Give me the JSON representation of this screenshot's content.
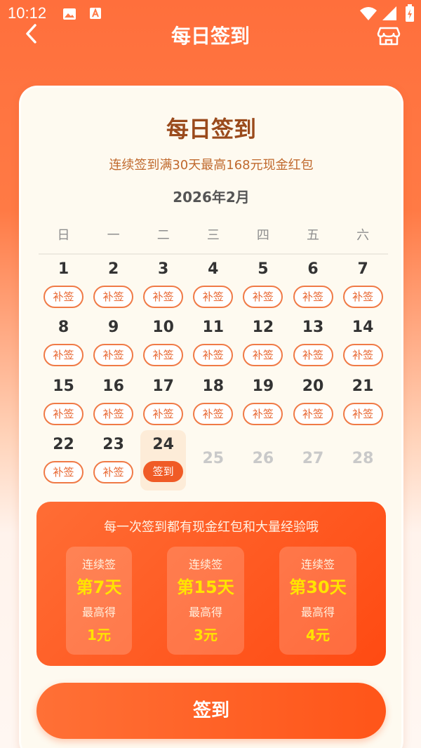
{
  "status_bar": {
    "time": "10:12"
  },
  "header": {
    "title": "每日签到"
  },
  "card": {
    "title": "每日签到",
    "subtitle": "连续签到满30天最高168元现金红包",
    "month": "2026年2月",
    "weekdays": [
      "日",
      "一",
      "二",
      "三",
      "四",
      "五",
      "六"
    ],
    "makeup_label": "补签",
    "sign_label": "签到",
    "days": [
      {
        "day": "1",
        "state": "missed"
      },
      {
        "day": "2",
        "state": "missed"
      },
      {
        "day": "3",
        "state": "missed"
      },
      {
        "day": "4",
        "state": "missed"
      },
      {
        "day": "5",
        "state": "missed"
      },
      {
        "day": "6",
        "state": "missed"
      },
      {
        "day": "7",
        "state": "missed"
      },
      {
        "day": "8",
        "state": "missed"
      },
      {
        "day": "9",
        "state": "missed"
      },
      {
        "day": "10",
        "state": "missed"
      },
      {
        "day": "11",
        "state": "missed"
      },
      {
        "day": "12",
        "state": "missed"
      },
      {
        "day": "13",
        "state": "missed"
      },
      {
        "day": "14",
        "state": "missed"
      },
      {
        "day": "15",
        "state": "missed"
      },
      {
        "day": "16",
        "state": "missed"
      },
      {
        "day": "17",
        "state": "missed"
      },
      {
        "day": "18",
        "state": "missed"
      },
      {
        "day": "19",
        "state": "missed"
      },
      {
        "day": "20",
        "state": "missed"
      },
      {
        "day": "21",
        "state": "missed"
      },
      {
        "day": "22",
        "state": "missed"
      },
      {
        "day": "23",
        "state": "missed"
      },
      {
        "day": "24",
        "state": "today"
      },
      {
        "day": "25",
        "state": "future"
      },
      {
        "day": "26",
        "state": "future"
      },
      {
        "day": "27",
        "state": "future"
      },
      {
        "day": "28",
        "state": "future"
      }
    ]
  },
  "rewards": {
    "title": "每一次签到都有现金红包和大量经验哦",
    "items": [
      {
        "line1": "连续签",
        "days": "第7天",
        "line3": "最高得",
        "amount": "1元"
      },
      {
        "line1": "连续签",
        "days": "第15天",
        "line3": "最高得",
        "amount": "3元"
      },
      {
        "line1": "连续签",
        "days": "第30天",
        "line3": "最高得",
        "amount": "4元"
      }
    ]
  },
  "sign_button": {
    "label": "签到"
  },
  "colors": {
    "accent": "#ff5a1f",
    "title_brown": "#9a4a1c",
    "reward_gold": "#ffe400"
  }
}
